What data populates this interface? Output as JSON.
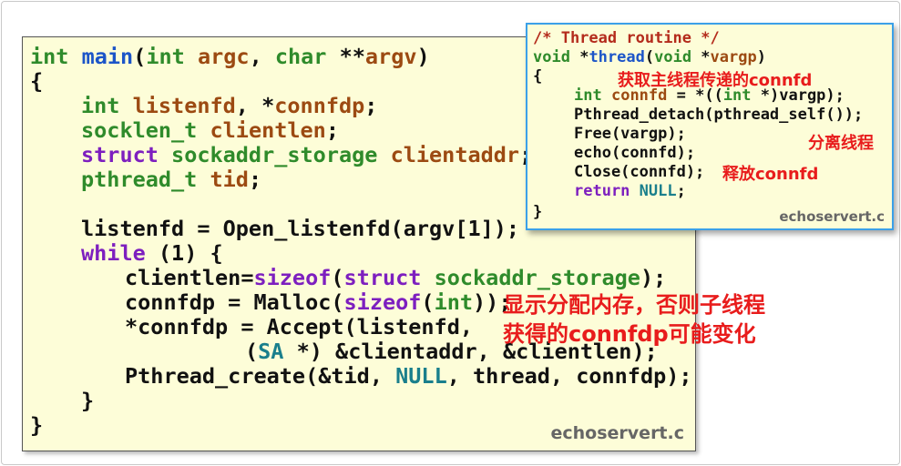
{
  "main_code": {
    "l1": {
      "a": "int",
      "b": " ",
      "c": "main",
      "d": "(",
      "e": "int",
      "f": " ",
      "g": "argc",
      "h": ", ",
      "i": "char",
      "j": " **",
      "k": "argv",
      "l": ")"
    },
    "l2": "{",
    "l3": {
      "a": "int",
      "b": " ",
      "c": "listenfd",
      "d": ", *",
      "e": "connfdp",
      "f": ";"
    },
    "l4": {
      "a": "socklen_t",
      "b": " ",
      "c": "clientlen",
      "d": ";"
    },
    "l5": {
      "a": "struct",
      "b": " ",
      "c": "sockaddr_storage",
      "d": " ",
      "e": "clientaddr",
      "f": ";"
    },
    "l6": {
      "a": "pthread_t",
      "b": " ",
      "c": "tid",
      "d": ";"
    },
    "l7": "listenfd = Open_listenfd(argv[1]);",
    "l8": {
      "a": "while",
      "b": " (1) {"
    },
    "l9": {
      "a": "clientlen=",
      "b": "sizeof",
      "c": "(",
      "d": "struct",
      "e": " ",
      "f": "sockaddr_storage",
      "g": ");"
    },
    "l10": {
      "a": "connfdp = Malloc(",
      "b": "sizeof",
      "c": "(",
      "d": "int",
      "e": "));"
    },
    "l11": "*connfdp = Accept(listenfd,",
    "l12": {
      "a": "(",
      "b": "SA",
      "c": " *) &clientaddr, &clientlen);"
    },
    "l13": {
      "a": "Pthread_create(&tid, ",
      "b": "NULL",
      "c": ", thread, connfdp);"
    },
    "l14": "}",
    "l15": "}",
    "source": "echoservert.c"
  },
  "thread_code": {
    "l1": "/* Thread routine */",
    "l2": {
      "a": "void",
      "b": " *",
      "c": "thread",
      "d": "(",
      "e": "void",
      "f": " *",
      "g": "vargp",
      "h": ")"
    },
    "l3": "{",
    "l4": {
      "a": "int",
      "b": " ",
      "c": "connfd",
      "d": " = *((",
      "e": "int",
      "f": " *)vargp);"
    },
    "l5": "Pthread_detach(pthread_self());",
    "l6": "Free(vargp);",
    "l7": "echo(connfd);",
    "l8": "Close(connfd);",
    "l9": {
      "a": "return",
      "b": " ",
      "c": "NULL",
      "d": ";"
    },
    "l10": "}",
    "source": "echoservert.c"
  },
  "annotations": {
    "get_connfd": "获取主线程传递的connfd",
    "detach": "分离线程",
    "release": "释放connfd",
    "malloc_note_1": "显示分配内存，否则子线程",
    "malloc_note_2": "获得的connfdp可能变化"
  }
}
